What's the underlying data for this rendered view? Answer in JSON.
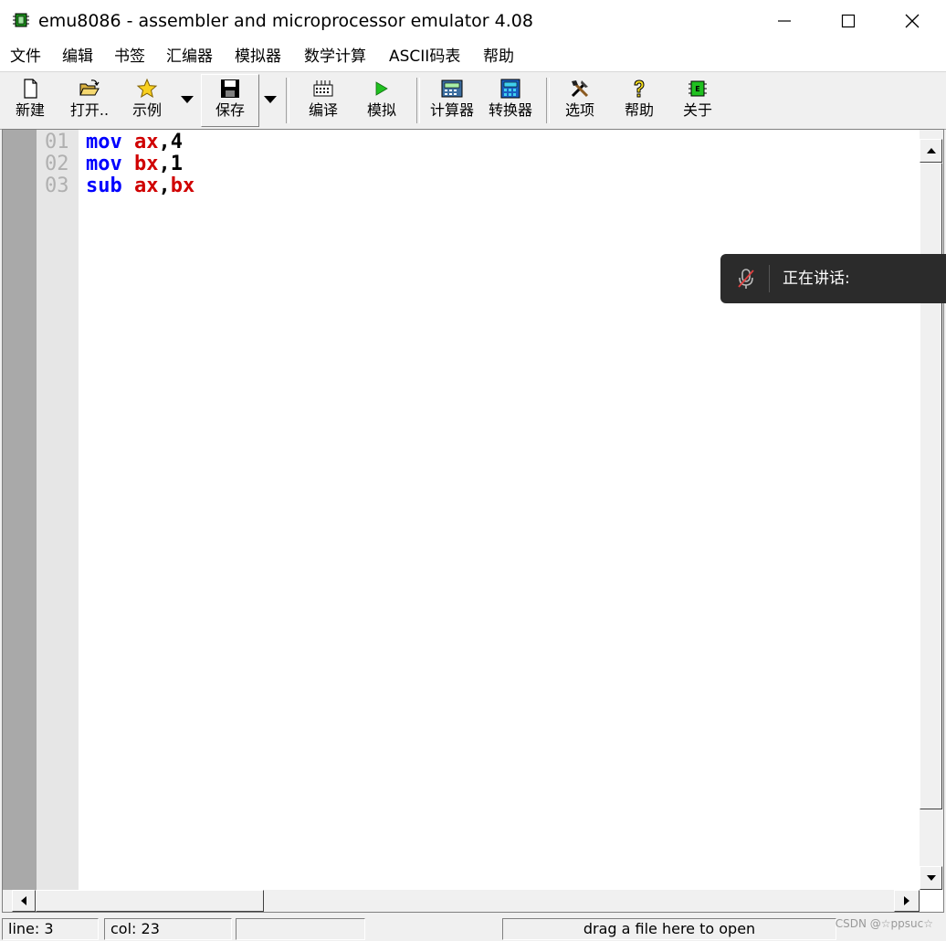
{
  "window": {
    "title": "emu8086 - assembler and microprocessor emulator 4.08"
  },
  "menu": {
    "items": [
      "文件",
      "编辑",
      "书签",
      "汇编器",
      "模拟器",
      "数学计算",
      "ASCII码表",
      "帮助"
    ]
  },
  "toolbar": {
    "new": "新建",
    "open": "打开..",
    "examples": "示例",
    "save": "保存",
    "compile": "编译",
    "emulate": "模拟",
    "calculator": "计算器",
    "converter": "转换器",
    "options": "选项",
    "help": "帮助",
    "about": "关于"
  },
  "editor": {
    "lines": [
      {
        "num": "01",
        "op": "mov",
        "a": "ax",
        "b": "4"
      },
      {
        "num": "02",
        "op": "mov",
        "a": "bx",
        "b": "1"
      },
      {
        "num": "03",
        "op": "sub",
        "a": "ax",
        "b": "bx"
      }
    ],
    "separator": ","
  },
  "status": {
    "line": "line: 3",
    "col": "col: 23",
    "hint": "drag a file here to open"
  },
  "overlay": {
    "speaking": "正在讲话:"
  },
  "watermark": "CSDN @☆ppsuc☆",
  "colors": {
    "keyword": "#0000ff",
    "register": "#d00000",
    "gutter": "#a9a9a9"
  }
}
